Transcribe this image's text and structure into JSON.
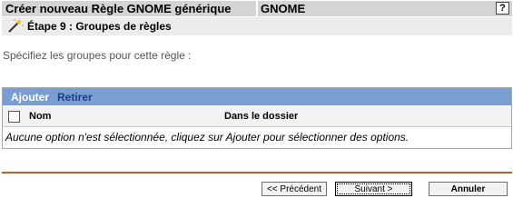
{
  "header": {
    "title": "Créer nouveau Règle GNOME générique",
    "context": "GNOME",
    "help_label": "?"
  },
  "step": {
    "icon": "wand-icon",
    "title": "Étape 9 : Groupes de règles"
  },
  "main": {
    "prompt": "Spécifiez les groupes pour cette règle :"
  },
  "grid": {
    "toolbar": {
      "add_label": "Ajouter",
      "remove_label": "Retirer"
    },
    "columns": [
      "Nom",
      "Dans le dossier"
    ],
    "empty_message": "Aucune option n'est sélectionnée, cliquez sur Ajouter pour sélectionner des options."
  },
  "buttons": {
    "previous": "<< Précédent",
    "next": "Suivant >",
    "cancel": "Annuler"
  },
  "colors": {
    "toolbar_bg": "#7a9ed2",
    "separator": "#c0602a",
    "title_bg": "#d4d4d4"
  }
}
